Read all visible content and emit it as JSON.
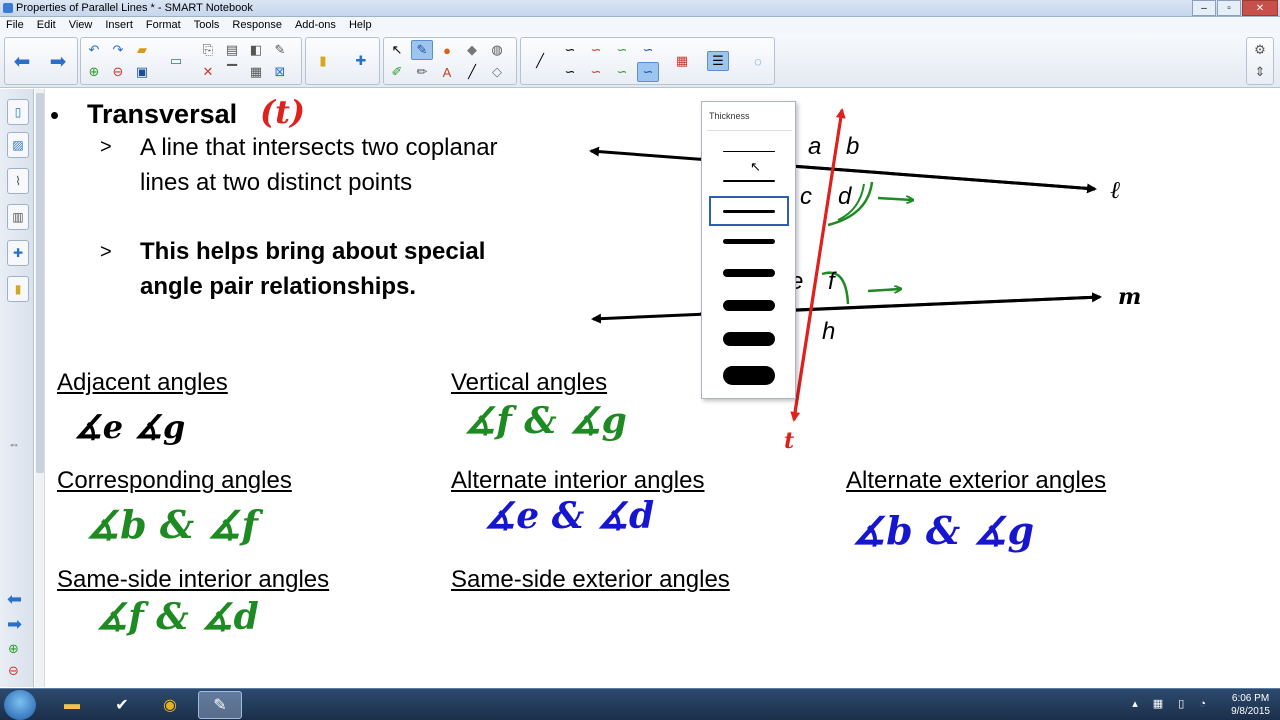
{
  "window": {
    "title": "Properties of Parallel Lines * - SMART Notebook"
  },
  "menu": [
    "File",
    "Edit",
    "View",
    "Insert",
    "Format",
    "Tools",
    "Response",
    "Add-ons",
    "Help"
  ],
  "page": {
    "bullet_title": "Transversal",
    "title_annotation": "(t)",
    "points": [
      {
        "marker": ">",
        "lines": [
          "A line that intersects two coplanar",
          "lines at two distinct points"
        ]
      },
      {
        "marker": ">",
        "lines": [
          "This helps bring about special",
          "angle pair relationships."
        ]
      }
    ],
    "headings": {
      "adjacent": "Adjacent angles",
      "vertical": "Vertical angles",
      "corresponding": "Corresponding angles",
      "alt_interior": "Alternate interior angles",
      "alt_exterior": "Alternate exterior angles",
      "same_side_interior": "Same-side interior angles",
      "same_side_exterior": "Same-side exterior angles"
    },
    "handwriting": {
      "adjacent": "∡e ∡g",
      "vertical": "∡f & ∡g",
      "corresponding": "∡b & ∡f",
      "alt_interior": "∡e & ∡d",
      "alt_exterior": "∡b & ∡g",
      "same_side_interior": "∡f & ∡d"
    },
    "diagram_labels": {
      "a": "a",
      "b": "b",
      "c": "c",
      "d": "d",
      "e": "e",
      "f": "f",
      "h": "h",
      "line_l": "ℓ",
      "line_m": "m",
      "transversal": "t"
    }
  },
  "thickness_popup": {
    "label": "Thickness",
    "options": [
      1,
      2,
      3,
      5,
      8,
      11,
      14,
      19
    ],
    "selected_index": 2
  },
  "taskbar": {
    "time": "6:06 PM",
    "date": "9/8/2015"
  },
  "colors": {
    "red": "#e0201c",
    "green": "#1e8a22",
    "blue": "#1616d0",
    "selection": "#2e5fb0"
  }
}
